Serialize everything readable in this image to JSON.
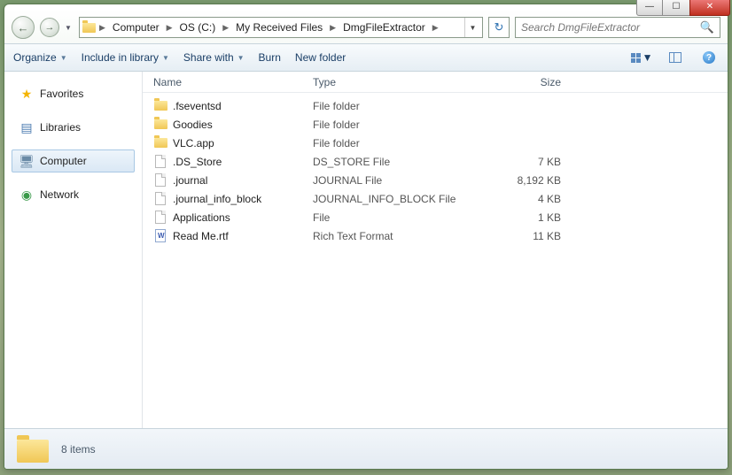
{
  "titlebar": {
    "min": "—",
    "max": "☐",
    "close": "✕"
  },
  "nav": {
    "back": "←",
    "forward": "→",
    "dropdown": "▼"
  },
  "breadcrumb": {
    "items": [
      "Computer",
      "OS (C:)",
      "My Received Files",
      "DmgFileExtractor"
    ]
  },
  "refresh": "↻",
  "search": {
    "placeholder": "Search DmgFileExtractor"
  },
  "toolbar": {
    "organize": "Organize",
    "include": "Include in library",
    "share": "Share with",
    "burn": "Burn",
    "newfolder": "New folder",
    "help": "?"
  },
  "sidebar": {
    "items": [
      {
        "label": "Favorites",
        "icon": "star"
      },
      {
        "label": "Libraries",
        "icon": "lib"
      },
      {
        "label": "Computer",
        "icon": "comp",
        "selected": true
      },
      {
        "label": "Network",
        "icon": "net"
      }
    ]
  },
  "columns": {
    "name": "Name",
    "type": "Type",
    "size": "Size"
  },
  "files": [
    {
      "name": ".fseventsd",
      "type": "File folder",
      "size": "",
      "kind": "folder"
    },
    {
      "name": "Goodies",
      "type": "File folder",
      "size": "",
      "kind": "folder"
    },
    {
      "name": "VLC.app",
      "type": "File folder",
      "size": "",
      "kind": "folder"
    },
    {
      "name": ".DS_Store",
      "type": "DS_STORE File",
      "size": "7 KB",
      "kind": "file"
    },
    {
      "name": ".journal",
      "type": "JOURNAL File",
      "size": "8,192 KB",
      "kind": "file"
    },
    {
      "name": ".journal_info_block",
      "type": "JOURNAL_INFO_BLOCK File",
      "size": "4 KB",
      "kind": "file"
    },
    {
      "name": "Applications",
      "type": "File",
      "size": "1 KB",
      "kind": "file"
    },
    {
      "name": "Read Me.rtf",
      "type": "Rich Text Format",
      "size": "11 KB",
      "kind": "rtf"
    }
  ],
  "status": {
    "text": "8 items"
  }
}
